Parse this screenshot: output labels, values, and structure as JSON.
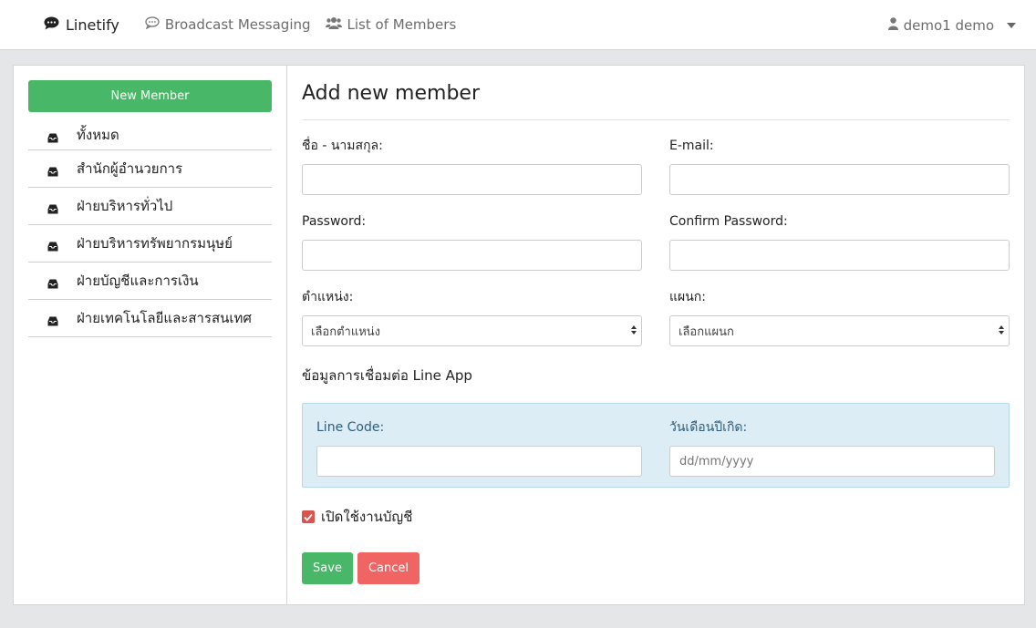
{
  "navbar": {
    "brand": "Linetify",
    "links": [
      {
        "label": "Broadcast Messaging",
        "icon": "comment-icon"
      },
      {
        "label": "List of Members",
        "icon": "users-icon"
      }
    ],
    "user": "demo1 demo"
  },
  "sidebar": {
    "new_member_label": "New Member",
    "items": [
      {
        "label": "ทั้งหมด"
      },
      {
        "label": "สำนักผู้อำนวยการ"
      },
      {
        "label": "ฝ่ายบริหารทั่วไป"
      },
      {
        "label": "ฝ่ายบริหารทรัพยากรมนุษย์"
      },
      {
        "label": "ฝ่ายบัญชีและการเงิน"
      },
      {
        "label": "ฝ่ายเทคโนโลยีและสารสนเทศ"
      }
    ]
  },
  "form": {
    "title": "Add new member",
    "fullname_label": "ชื่อ - นามสกุล:",
    "fullname_value": "",
    "email_label": "E-mail:",
    "email_value": "",
    "password_label": "Password:",
    "password_value": "",
    "confirm_password_label": "Confirm Password:",
    "confirm_password_value": "",
    "position_label": "ตำแหน่ง:",
    "position_selected": "เลือกตำแหน่ง",
    "department_label": "แผนก:",
    "department_selected": "เลือกแผนก",
    "line_section_title": "ข้อมูลการเชื่อมต่อ Line App",
    "line_code_label": "Line Code:",
    "line_code_value": "",
    "birthdate_label": "วันเดือนปีเกิด:",
    "birthdate_placeholder": "dd/mm/yyyy",
    "enable_account_label": "เปิดใช้งานบัญชี",
    "enable_account_checked": true,
    "save_label": "Save",
    "cancel_label": "Cancel"
  },
  "colors": {
    "success": "#48b768",
    "danger": "#f06464",
    "checkbox": "#d9534f",
    "info_bg": "#dcedf6"
  }
}
